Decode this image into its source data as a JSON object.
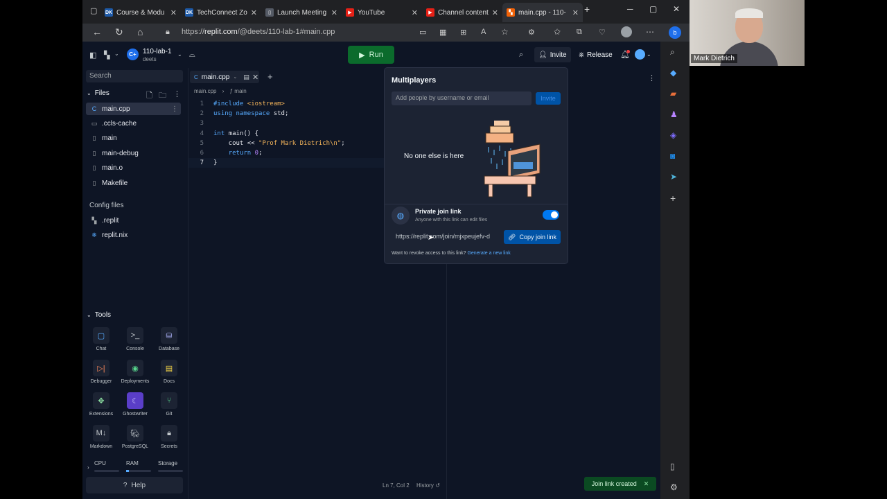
{
  "browser": {
    "tabs": [
      {
        "title": "Course & Modu",
        "icon": "d2l-icon",
        "color": "#1e5aa8",
        "glyph": "DK"
      },
      {
        "title": "TechConnect Zo",
        "icon": "d2l-icon",
        "color": "#1e5aa8",
        "glyph": "DK"
      },
      {
        "title": "Launch Meeting",
        "icon": "document-icon",
        "color": "#555b66",
        "glyph": "▯"
      },
      {
        "title": "YouTube",
        "icon": "youtube-icon",
        "color": "#e62117",
        "glyph": "▶"
      },
      {
        "title": "Channel content",
        "icon": "youtube-icon",
        "color": "#e62117",
        "glyph": "▶"
      },
      {
        "title": "main.cpp - 110-",
        "icon": "replit-icon",
        "color": "#f26207",
        "glyph": "▚"
      }
    ],
    "url_prefix": "https://",
    "url_domain": "replit.com",
    "url_path": "/@deets/110-lab-1#main.cpp"
  },
  "webcam": {
    "name": "Mark Dietrich"
  },
  "topbar": {
    "project_name": "110-lab-1",
    "owner": "deets",
    "run_label": "Run",
    "invite_label": "Invite",
    "release_label": "Release"
  },
  "sidebar": {
    "search_placeholder": "Search",
    "files_label": "Files",
    "files": [
      {
        "name": "main.cpp",
        "active": true
      },
      {
        "name": ".ccls-cache"
      },
      {
        "name": "main"
      },
      {
        "name": "main-debug"
      },
      {
        "name": "main.o"
      },
      {
        "name": "Makefile"
      }
    ],
    "config_label": "Config files",
    "config_files": [
      {
        "name": ".replit"
      },
      {
        "name": "replit.nix"
      }
    ],
    "tools_label": "Tools",
    "tools": [
      {
        "label": "Chat",
        "icon": "chat-icon"
      },
      {
        "label": "Console",
        "icon": "console-icon"
      },
      {
        "label": "Database",
        "icon": "database-icon"
      },
      {
        "label": "Debugger",
        "icon": "debugger-icon"
      },
      {
        "label": "Deployments",
        "icon": "deployments-icon"
      },
      {
        "label": "Docs",
        "icon": "docs-icon"
      },
      {
        "label": "Extensions",
        "icon": "extensions-icon"
      },
      {
        "label": "Ghostwriter",
        "icon": "ghostwriter-icon"
      },
      {
        "label": "Git",
        "icon": "git-icon"
      },
      {
        "label": "Markdown",
        "icon": "markdown-icon"
      },
      {
        "label": "PostgreSQL",
        "icon": "postgresql-icon"
      },
      {
        "label": "Secrets",
        "icon": "secrets-icon"
      }
    ],
    "cpu_label": "CPU",
    "ram_label": "RAM",
    "storage_label": "Storage",
    "help_label": "Help"
  },
  "editor": {
    "tab_label": "main.cpp",
    "crumb_file": "main.cpp",
    "crumb_symbol": "main",
    "lines": [
      [
        "#include <iostream>"
      ],
      [
        "using namespace std;"
      ],
      [
        ""
      ],
      [
        "int main() {"
      ],
      [
        "    cout << \"Prof Mark Dietrich\\n\";"
      ],
      [
        "    return 0;"
      ],
      [
        "}"
      ]
    ],
    "cursor_pos": "Ln 7, Col 2",
    "history_label": "History"
  },
  "multiplayers": {
    "title": "Multiplayers",
    "add_placeholder": "Add people by username or email",
    "invite_label": "Invite",
    "empty_text": "No one else is here",
    "private_link_title": "Private join link",
    "private_link_sub": "Anyone with this link can edit files",
    "toggle_on": true,
    "join_link": "https://replit.com/join/mjxpeujefv-d",
    "copy_label": "Copy join link",
    "revoke_text": "Want to revoke access to this link?",
    "generate_label": "Generate a new link"
  },
  "toast": {
    "text": "Join link created"
  },
  "colors": {
    "accent": "#0079f2",
    "run_green": "#0b6b2c",
    "bg": "#0e1525"
  }
}
